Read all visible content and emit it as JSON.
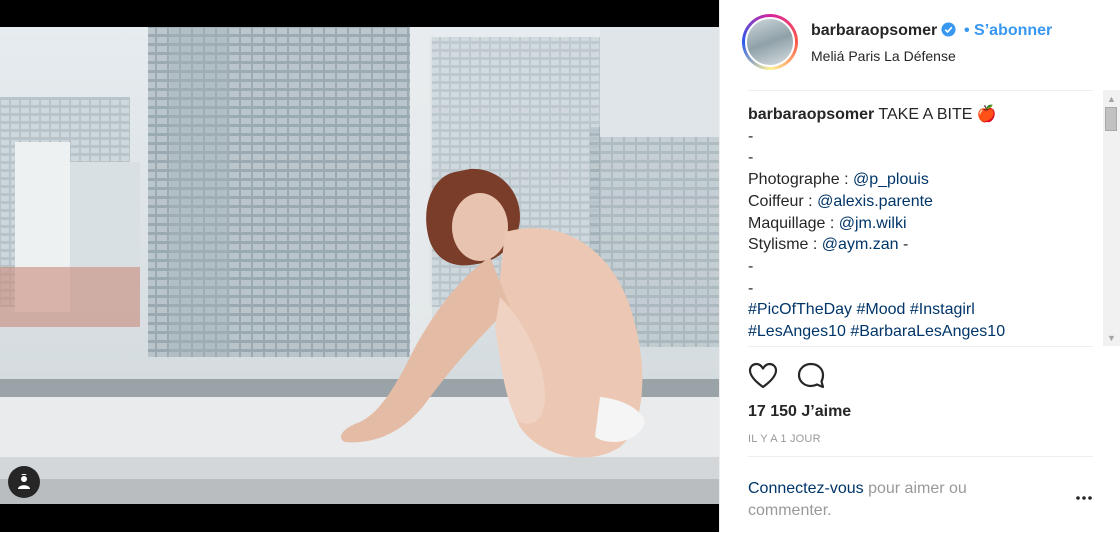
{
  "post": {
    "username": "barbaraopsomer",
    "follow_label": "• S’abonner",
    "location": "Meliá Paris La Défense",
    "caption": {
      "username": "barbaraopsomer",
      "title": "TAKE A BITE",
      "title_emoji": "🍎",
      "lines": [
        {
          "prefix": "-",
          "link": "",
          "suffix": ""
        },
        {
          "prefix": "-",
          "link": "",
          "suffix": ""
        },
        {
          "prefix": "Photographe : ",
          "link": "@p_plouis",
          "suffix": ""
        },
        {
          "prefix": "Coiffeur : ",
          "link": "@alexis.parente",
          "suffix": ""
        },
        {
          "prefix": "Maquillage : ",
          "link": "@jm.wilki",
          "suffix": ""
        },
        {
          "prefix": "Stylisme : ",
          "link": "@aym.zan",
          "suffix": " -"
        },
        {
          "prefix": "-",
          "link": "",
          "suffix": ""
        },
        {
          "prefix": "-",
          "link": "",
          "suffix": ""
        }
      ],
      "hashtags_1": [
        "#PicOfTheDay",
        "#Mood",
        "#Instagirl"
      ],
      "hashtags_2": [
        "#LesAnges10",
        "#BarbaraLesAnges10"
      ]
    },
    "likes": "17 150 J’aime",
    "time_ago": "IL Y A 1 JOUR",
    "login_link": "Connectez-vous",
    "login_rest": " pour aimer ou commenter.",
    "icons": {
      "tag": "user-tag-icon",
      "verified": "verified-badge-icon",
      "like": "heart-icon",
      "comment": "comment-bubble-icon",
      "more": "more-options-icon"
    },
    "colors": {
      "link_blue": "#3897f0",
      "link_dark": "#003569",
      "muted": "#999999",
      "text": "#262626"
    }
  }
}
